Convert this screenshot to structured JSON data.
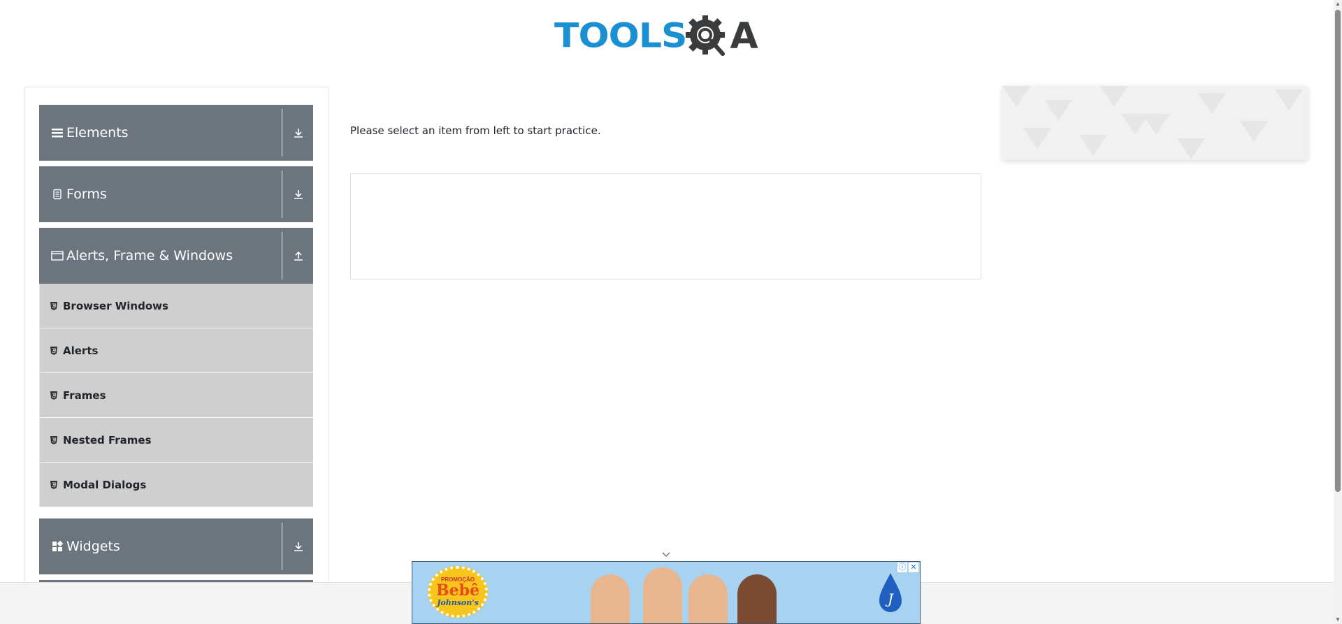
{
  "header": {
    "logo_text_primary": "TOOLS",
    "logo_text_secondary": "A",
    "logo_icon": "gear-magnifier-icon"
  },
  "sidebar": {
    "groups": [
      {
        "label": "Elements",
        "icon": "hamburger-icon",
        "expanded": false
      },
      {
        "label": "Forms",
        "icon": "form-icon",
        "expanded": false
      },
      {
        "label": "Alerts, Frame & Windows",
        "icon": "window-icon",
        "expanded": true,
        "items": [
          {
            "label": "Browser Windows"
          },
          {
            "label": "Alerts"
          },
          {
            "label": "Frames"
          },
          {
            "label": "Nested Frames"
          },
          {
            "label": "Modal Dialogs"
          }
        ]
      },
      {
        "label": "Widgets",
        "icon": "grid-icon",
        "expanded": false
      },
      {
        "label": "",
        "icon": "",
        "expanded": false
      }
    ]
  },
  "main": {
    "instruction": "Please select an item from left to start practice."
  },
  "bottom_ad": {
    "badge_line1": "PROMOÇÃO",
    "badge_line2": "Bebê",
    "badge_line3": "Johnson's"
  },
  "colors": {
    "group_bg": "#6c757d",
    "subitem_bg": "#cfcfcf",
    "logo_blue": "#1a8fd1",
    "logo_dark": "#3a3b3c"
  }
}
